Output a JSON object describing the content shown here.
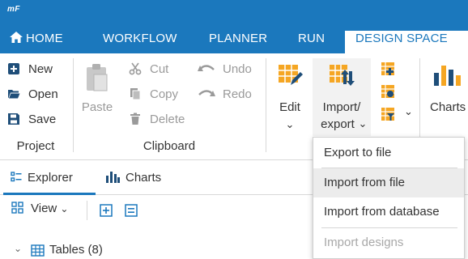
{
  "app": {
    "logo": "mF"
  },
  "nav": {
    "tabs": [
      {
        "label": "HOME",
        "icon": "home-icon"
      },
      {
        "label": "WORKFLOW"
      },
      {
        "label": "PLANNER"
      },
      {
        "label": "RUN"
      },
      {
        "label": "DESIGN SPACE",
        "active": true
      }
    ]
  },
  "ribbon": {
    "project": {
      "label": "Project",
      "new": "New",
      "open": "Open",
      "save": "Save"
    },
    "clipboard": {
      "label": "Clipboard",
      "paste": "Paste",
      "cut": "Cut",
      "copy": "Copy",
      "delete": "Delete",
      "undo": "Undo",
      "redo": "Redo"
    },
    "edit": {
      "label": "Edit",
      "caret": "⌄"
    },
    "import_export": {
      "label_line1": "Import/",
      "label_line2": "export",
      "caret": "⌄"
    },
    "small_caret": "⌄",
    "charts": {
      "label": "Charts"
    }
  },
  "panel": {
    "tabs": [
      {
        "label": "Explorer",
        "active": true
      },
      {
        "label": "Charts"
      }
    ],
    "toolbar": {
      "view": "View",
      "caret": "⌄"
    },
    "tree": {
      "tables": "Tables (8)",
      "caret": "⌄"
    }
  },
  "menu": {
    "items": [
      {
        "label": "Export to file"
      },
      {
        "label": "Import from file",
        "hover": true
      },
      {
        "label": "Import from database"
      },
      {
        "label": "Import designs",
        "disabled": true
      }
    ]
  },
  "colors": {
    "brand": "#1b78bd",
    "accent_orange": "#f5a623",
    "disabled_text": "#9a9a9a"
  }
}
